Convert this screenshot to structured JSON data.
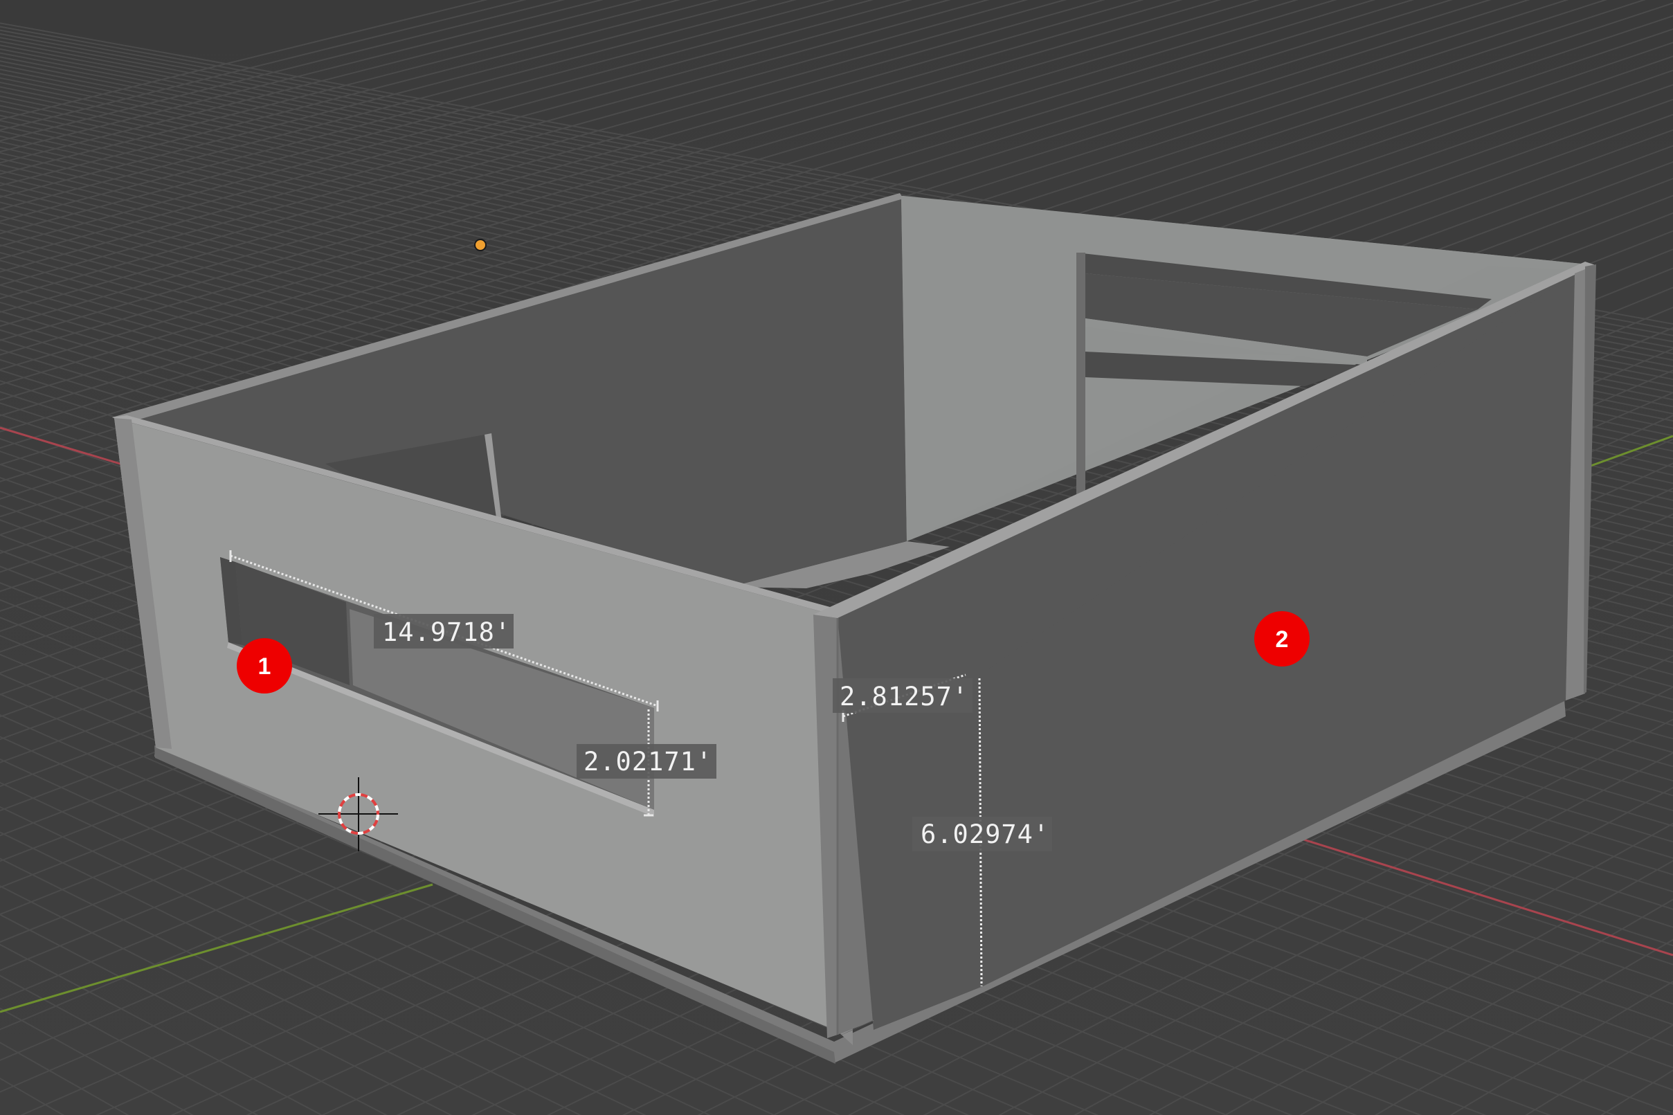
{
  "viewport": {
    "background": "#3d3d3d",
    "grid_color": "#4a4a4a",
    "axis_colors": {
      "x": "#a8444e",
      "y": "#6d8f2e"
    }
  },
  "measurements": [
    {
      "id": "window-length",
      "text": "14.9718'"
    },
    {
      "id": "window-height",
      "text": "2.02171'"
    },
    {
      "id": "door-width",
      "text": "2.81257'"
    },
    {
      "id": "door-height",
      "text": "6.02974'"
    }
  ],
  "markers": [
    {
      "id": "1",
      "label": "1",
      "color": "#ee0000"
    },
    {
      "id": "2",
      "label": "2",
      "color": "#ee0000"
    }
  ],
  "icons": {
    "light": "light-icon",
    "cursor": "3d-cursor-icon"
  }
}
